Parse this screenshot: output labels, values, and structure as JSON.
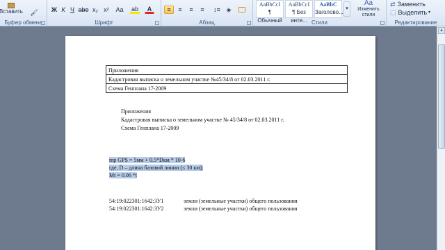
{
  "ribbon": {
    "clipboard": {
      "label": "Буфер обмена",
      "paste": "Вставить"
    },
    "font": {
      "label": "Шрифт",
      "bold": "Ж",
      "italic": "К",
      "underline": "Ч",
      "strike": "abe",
      "subscript": "x₂",
      "superscript": "x²",
      "case": "Aa",
      "highlight": "ab",
      "font_color": "A"
    },
    "paragraph": {
      "label": "Абзац"
    },
    "styles": {
      "label": "Стили",
      "items": [
        {
          "sample": "AaBbCcI",
          "name": "¶ Обычный"
        },
        {
          "sample": "AaBbCcI",
          "name": "¶ Без инте..."
        },
        {
          "sample": "AaBbC",
          "name": "Заголово..."
        }
      ],
      "change": "Изменить стили"
    },
    "editing": {
      "label": "Редактирование",
      "replace": "Заменить",
      "select": "Выделить"
    }
  },
  "document": {
    "table": [
      "Приложения",
      "Кадастровая выписка о земельном участке №45/34/8 от 02.03.2011 г.",
      "Схема Генплана 17-2009"
    ],
    "list": [
      "Приложения",
      "Кадастровая выписка о земельном участке № 45/34/8 от 02.03.2011 г.",
      "Схема Генплана 17-2009"
    ],
    "formula": [
      "mp GPS = 5мм + 0.5*Dкм * 10-6",
      "где, D – длина базовой линии (≤ 30 км);",
      "Mt = 0.06 *t"
    ],
    "parcels": [
      {
        "id": "54:19:022301:1642:ЗУ1",
        "desc": "земли (земельные участки) общего пользования"
      },
      {
        "id": "54:19:022301:1642:ЗУ2",
        "desc": "земли (земельные участки) общего пользования"
      }
    ]
  }
}
